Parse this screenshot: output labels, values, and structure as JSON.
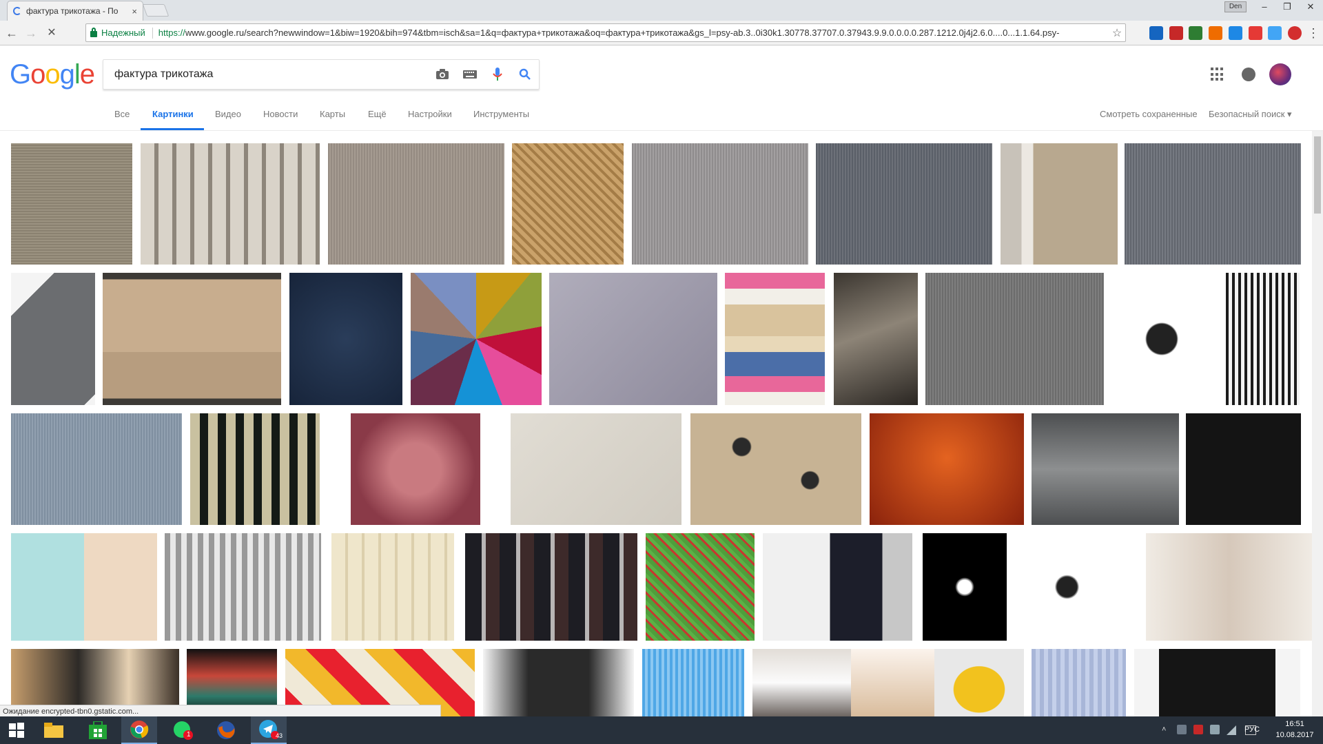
{
  "browser": {
    "tab_title": "фактура трикотажа - По",
    "tab_close": "×",
    "user_chip": "Den",
    "win_min": "–",
    "win_max": "❐",
    "win_close": "✕",
    "secure_label": "Надежный",
    "url_scheme": "https://",
    "url_rest": "www.google.ru/search?newwindow=1&biw=1920&bih=974&tbm=isch&sa=1&q=фактура+трикотажа&oq=фактура+трикотажа&gs_l=psy-ab.3..0i30k1.30778.37707.0.37943.9.9.0.0.0.0.287.1212.0j4j2.6.0....0...1.1.64.psy-",
    "back": "←",
    "forward": "→",
    "stop": "✕",
    "star": "☆",
    "menu": "⋮"
  },
  "google": {
    "logo_letters": [
      "G",
      "o",
      "o",
      "g",
      "l",
      "e"
    ],
    "logo_colors": [
      "#4285f4",
      "#ea4335",
      "#fbbc05",
      "#4285f4",
      "#34a853",
      "#ea4335"
    ],
    "query": "фактура трикотажа",
    "tabs": [
      "Все",
      "Картинки",
      "Видео",
      "Новости",
      "Карты",
      "Ещё",
      "Настройки",
      "Инструменты"
    ],
    "active_tab": "Картинки",
    "saved": "Смотреть сохраненные",
    "safesearch": "Безопасный поиск ▾"
  },
  "status": "Ожидание encrypted-tbn0.gstatic.com...",
  "taskbar": {
    "whatsapp_badge": "1",
    "telegram_badge": "43",
    "lang": "РУС",
    "time": "16:51",
    "date": "10.08.2017"
  },
  "images": {
    "row1": [
      "texture-beige-knit",
      "texture-braided-cord",
      "texture-grey-rib",
      "texture-tan-diagonal-knit",
      "texture-light-grey-rib",
      "texture-dark-grey-rib",
      "texture-beige-with-stripe",
      "texture-grey-melange"
    ],
    "row2": [
      "grey-cable-sweater",
      "knit-poncho-model",
      "navy-wool",
      "fabric-color-swatches",
      "lilac-fabric",
      "folded-knit-stack",
      "knit-lace-garment",
      "grey-jersey",
      "lace-knit-chart",
      "knit-pattern-chart"
    ],
    "row3": [
      "blue-grey-knit",
      "black-cream-stripes",
      "pink-boucle",
      "linen-beige",
      "leopard-knit",
      "orange-knit",
      "grey-cord-applique",
      "black-fabric"
    ],
    "row4": [
      "model-knit-dress",
      "knit-stitch-diagram",
      "cream-cable-knit",
      "runway-models",
      "green-jacquard-knit",
      "fashion-dress-print",
      "black-white-grunge-texture",
      "lace-pattern-chart",
      "fashion-sketch-figures"
    ],
    "row5": [
      "knit-hats-models",
      "runway-colorful-knit",
      "argyle-knit",
      "leather-jacket-model",
      "blue-knit-closeup",
      "woman-white-top",
      "fashion-sketch",
      "yellow-chunky-braid",
      "blue-cable-knit",
      "black-puff-sleeve"
    ]
  }
}
